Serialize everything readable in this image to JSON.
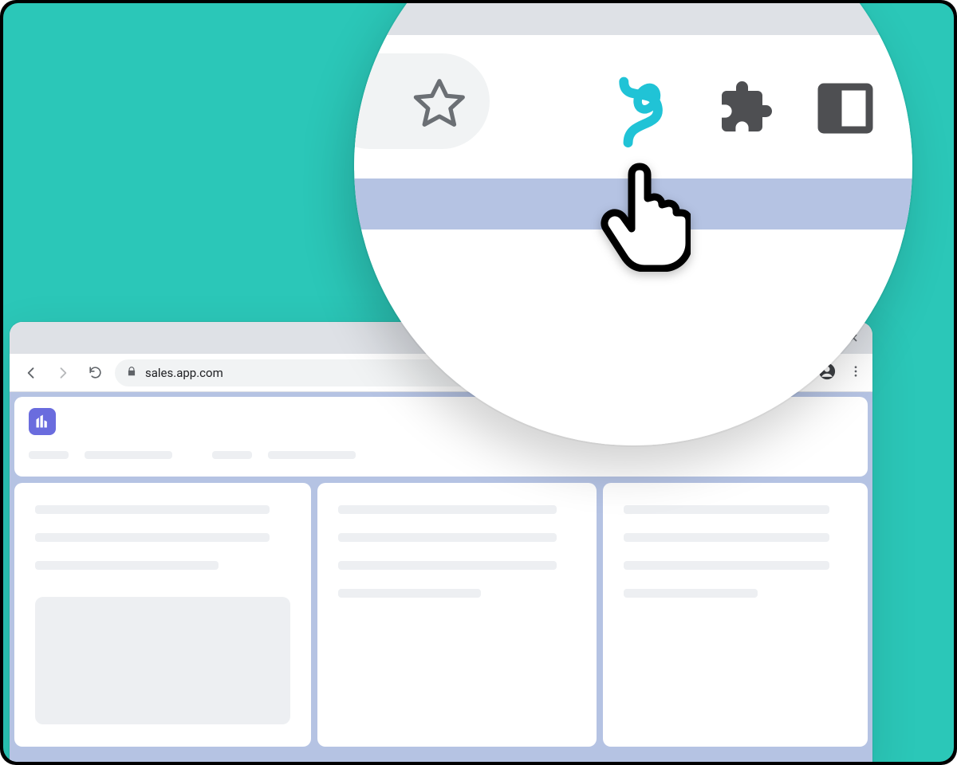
{
  "browser": {
    "url": "sales.app.com",
    "icons": {
      "back": "back-icon",
      "forward": "forward-icon",
      "reload": "reload-icon",
      "lock": "lock-icon",
      "share": "share-icon",
      "star": "star-icon",
      "extension_evo": "evo-extension-icon",
      "puzzle": "extensions-icon",
      "sidepanel": "sidepanel-icon",
      "profile": "profile-icon",
      "kebab": "kebab-menu-icon",
      "minimize": "minimize-icon",
      "maximize": "maximize-icon",
      "close": "close-icon"
    }
  },
  "colors": {
    "teal": "#2BC7B8",
    "lavender": "#B5C3E3",
    "accent": "#20C3D6"
  }
}
